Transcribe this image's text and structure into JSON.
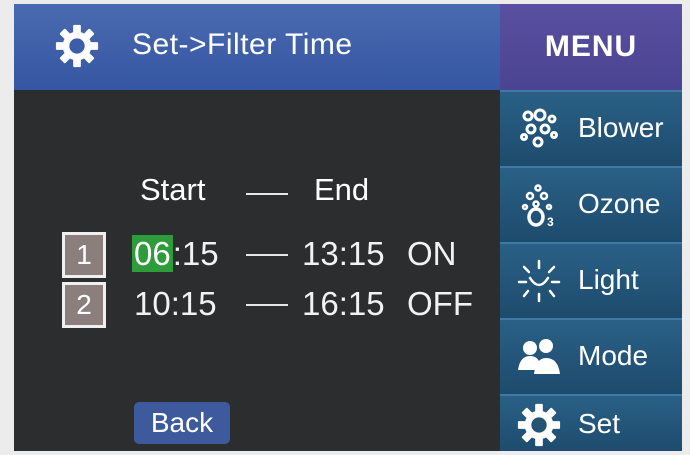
{
  "header": {
    "title": "Set->Filter Time",
    "icon": "gear-icon"
  },
  "columns": {
    "start": "Start",
    "end": "End"
  },
  "rows": [
    {
      "number": "1",
      "start_hour": "06",
      "start_rest": ":15",
      "end": "13:15",
      "status": "ON"
    },
    {
      "number": "2",
      "start": "10:15",
      "end": "16:15",
      "status": "OFF"
    }
  ],
  "back_label": "Back",
  "menu": {
    "title": "MENU",
    "items": [
      {
        "label": "Blower",
        "icon": "bubbles-icon"
      },
      {
        "label": "Ozone",
        "icon": "ozone-icon"
      },
      {
        "label": "Light",
        "icon": "light-icon"
      },
      {
        "label": "Mode",
        "icon": "users-icon"
      },
      {
        "label": "Set",
        "icon": "gear-icon"
      }
    ]
  },
  "colors": {
    "header_blue": "#3556a2",
    "menu_purple": "#4a4492",
    "menu_item_blue": "#1d4b6d",
    "highlight_green": "#2e9c3a",
    "background_dark": "#2b2d2f"
  }
}
